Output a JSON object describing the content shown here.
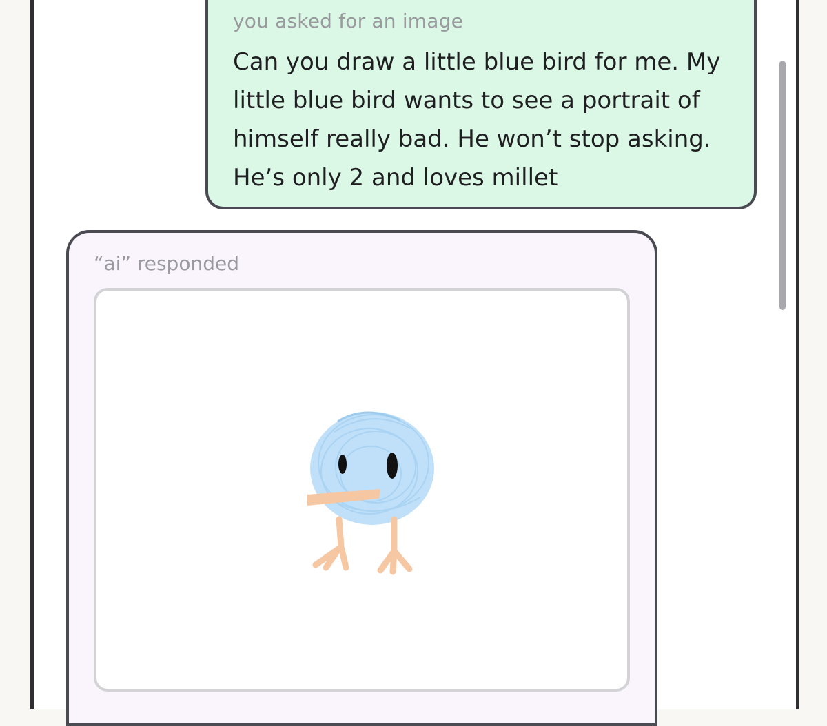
{
  "user_message": {
    "label": "you asked for an image",
    "text": "Can you draw a little blue bird for me. My little blue bird wants to see a portrait of himself really bad. He won’t stop asking. He’s only 2 and loves millet",
    "bubble_color": "#dbf8e6"
  },
  "ai_response": {
    "label": "“ai” responded",
    "image_icon": "blue-bird-drawing",
    "bubble_color": "#faf5fd"
  },
  "colors": {
    "bird_blue": "#bfe0f8",
    "beak_feet": "#f6c7a3",
    "outline": "#4a4a52"
  }
}
